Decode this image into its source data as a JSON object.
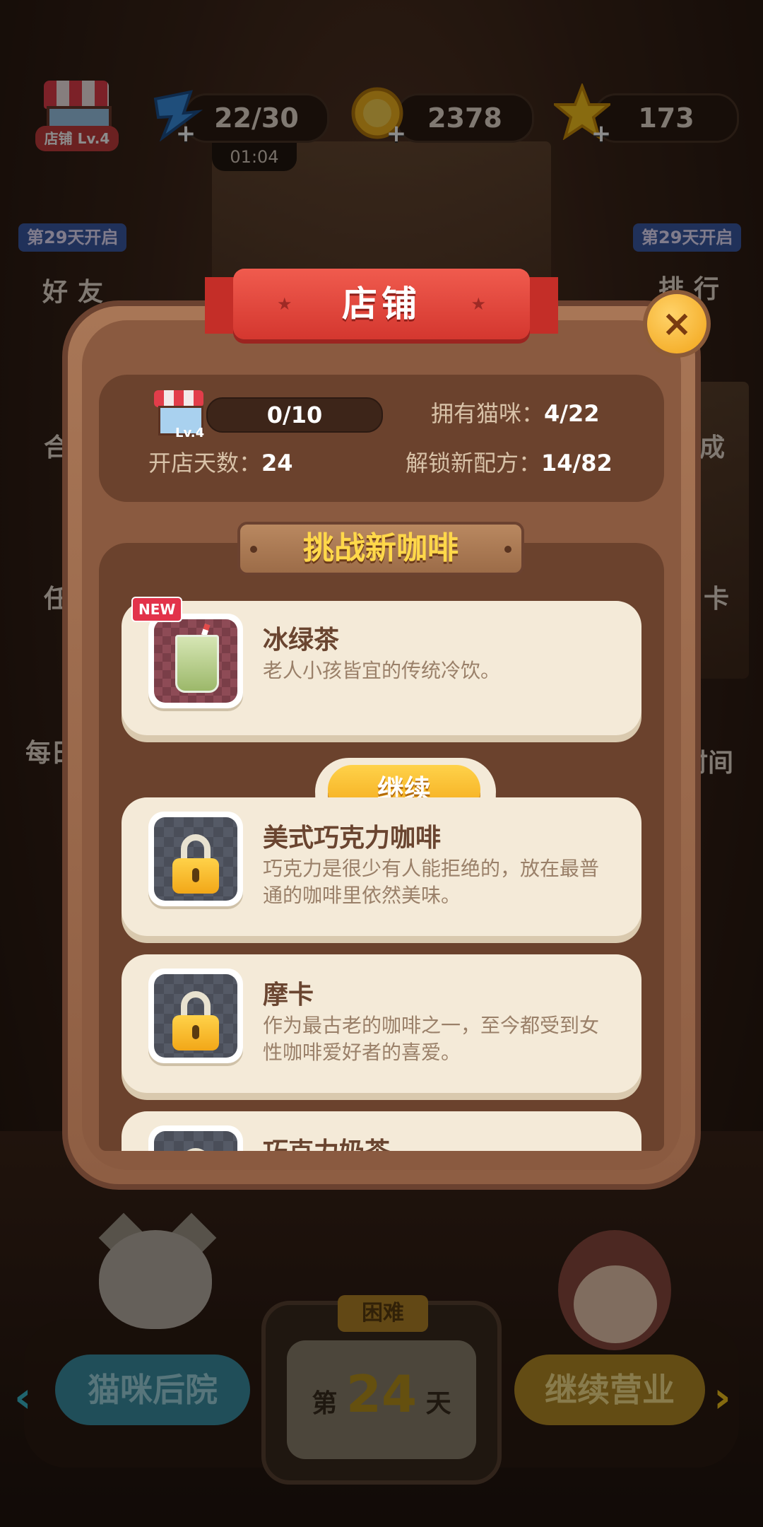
{
  "hud": {
    "shop_label": "店铺 Lv.4",
    "energy": "22/30",
    "energy_timer": "01:04",
    "coins": "2378",
    "stars": "173",
    "plus": "+"
  },
  "side_menu": {
    "left_tag": "第29天开启",
    "left_label": "好友",
    "right_tag": "第29天开启",
    "right_label": "排行",
    "left_partial": [
      "合",
      "任",
      "每日"
    ],
    "right_partial": [
      "成",
      "卡",
      "时间"
    ]
  },
  "modal": {
    "title": "店铺",
    "close": "×",
    "progress_text": "0/10",
    "progress_value": 0,
    "shop_level": "Lv.4",
    "cats_label": "拥有猫咪：",
    "cats_value": "4/22",
    "days_label": "开店天数：",
    "days_value": "24",
    "recipes_label": "解锁新配方：",
    "recipes_value": "14/82",
    "section_title": "挑战新咖啡",
    "items": [
      {
        "badge": "NEW",
        "title": "冰绿茶",
        "desc": "老人小孩皆宜的传统冷饮。",
        "button": "继续"
      },
      {
        "title": "美式巧克力咖啡",
        "desc": "巧克力是很少有人能拒绝的，放在最普通的咖啡里依然美味。"
      },
      {
        "title": "摩卡",
        "desc": "作为最古老的咖啡之一，至今都受到女性咖啡爱好者的喜爱。"
      },
      {
        "title": "巧克力奶茶"
      }
    ]
  },
  "bottom": {
    "backyard": "猫咪后院",
    "continue_business": "继续营业",
    "difficulty": "困难",
    "day_prefix": "第",
    "day_number": "24",
    "day_suffix": "天",
    "arrow_left": "‹",
    "arrow_right": "›"
  },
  "colors": {
    "accent_yellow": "#f3a819",
    "ribbon_red": "#e24a40",
    "panel_brown": "#6b422d",
    "card_cream": "#f4ead8"
  }
}
